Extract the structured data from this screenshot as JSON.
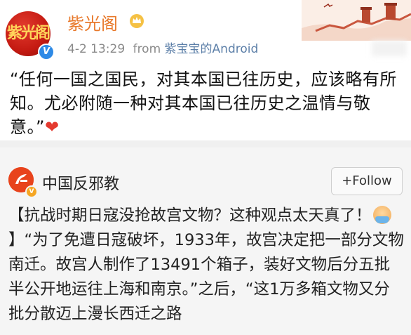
{
  "post": {
    "avatar_text": "紫光阁",
    "user_name": "紫光阁",
    "timestamp": "4-2 13:29",
    "from_label": "from",
    "source": "紫宝宝的Android",
    "text": "“任何一国之国民，对其本国已往历史，应该略有所知。尤必附随一种对其本国已往历史之温情与敬意。”",
    "heart": "❤",
    "name_color": "#e8792b"
  },
  "repost": {
    "avatar_icon": "falun-logo-icon",
    "user_name": "中国反邪教",
    "follow_label": "+Follow",
    "text_part1": "【抗战时期日寇没抢故宫文物？这种观点太天真了！",
    "text_part2": "】“为了免遭日寇破坏，1933年，故宫决定把一部分文物南迁。故宫人制作了13491个箱子，装好文物后分五批半公开地运往上海和南京。”之后，“这1万多箱文物又分批分散迈上漫长",
    "text_overflow": "西迁之路"
  }
}
